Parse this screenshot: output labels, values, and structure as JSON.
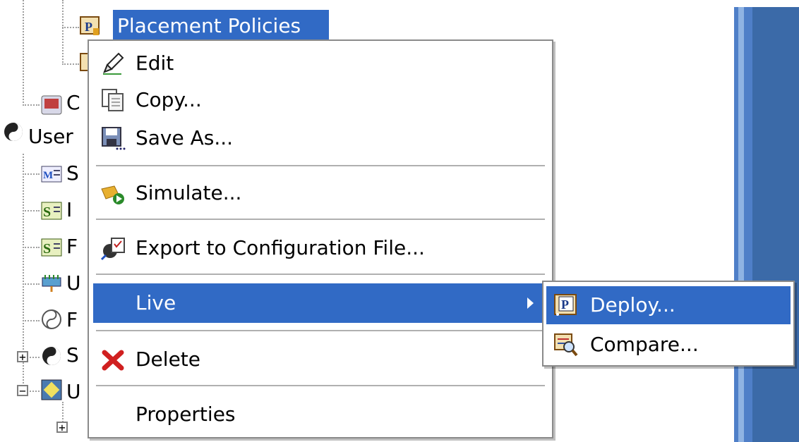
{
  "tree": {
    "selected_node": "Placement Policies",
    "visible_fragments": [
      "C",
      "User",
      "S",
      "I",
      "F",
      "U",
      "F",
      "S",
      "U"
    ],
    "expanders": [
      "+",
      "−",
      "+"
    ]
  },
  "context_menu": {
    "items": [
      {
        "label": "Edit",
        "icon": "pencil-icon"
      },
      {
        "label": "Copy...",
        "icon": "copy-icon"
      },
      {
        "label": "Save As...",
        "icon": "save-icon"
      },
      {
        "label": "Simulate...",
        "icon": "simulate-icon"
      },
      {
        "label": "Export to Configuration File...",
        "icon": "export-icon"
      },
      {
        "label": "Live",
        "icon": ""
      },
      {
        "label": "Delete",
        "icon": "delete-icon"
      },
      {
        "label": "Properties",
        "icon": ""
      }
    ],
    "highlighted": "Live"
  },
  "submenu": {
    "items": [
      {
        "label": "Deploy...",
        "icon": "deploy-policy-icon"
      },
      {
        "label": "Compare...",
        "icon": "compare-icon"
      }
    ],
    "highlighted": "Deploy..."
  },
  "colors": {
    "selection": "#316ac5",
    "menu_border": "#8a8a8a",
    "pane_blue": "#3b6aa8"
  }
}
